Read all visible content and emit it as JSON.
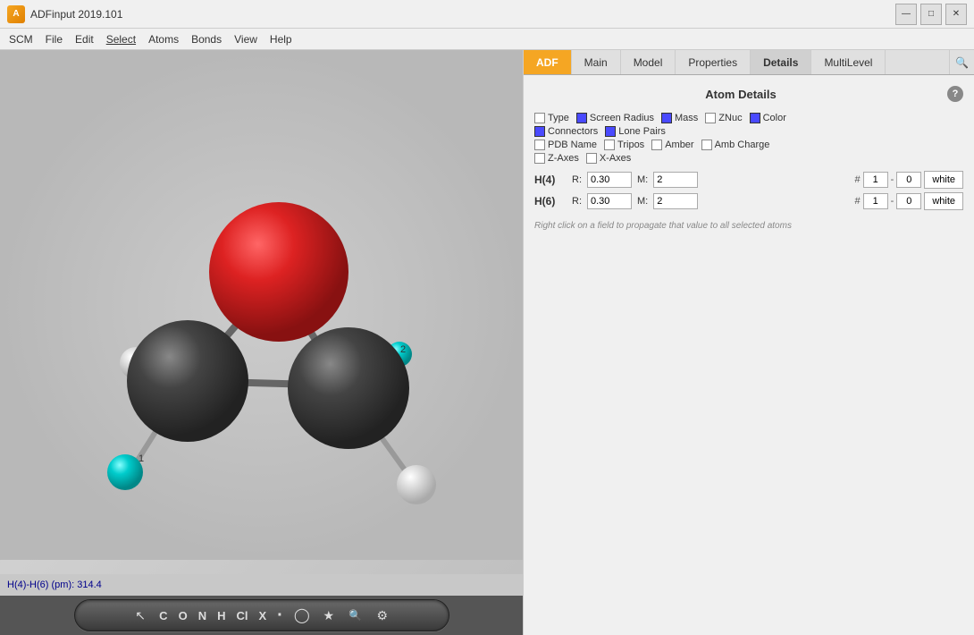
{
  "app": {
    "title": "ADFinput 2019.101",
    "icon_label": "A"
  },
  "titlebar": {
    "minimize_label": "—",
    "maximize_label": "□",
    "close_label": "✕"
  },
  "menubar": {
    "items": [
      {
        "label": "SCM"
      },
      {
        "label": "File"
      },
      {
        "label": "Edit"
      },
      {
        "label": "Select"
      },
      {
        "label": "Atoms"
      },
      {
        "label": "Bonds"
      },
      {
        "label": "View"
      },
      {
        "label": "Help"
      }
    ]
  },
  "tabs": [
    {
      "label": "ADF",
      "active": true
    },
    {
      "label": "Main"
    },
    {
      "label": "Model"
    },
    {
      "label": "Properties"
    },
    {
      "label": "Details",
      "bold": true
    },
    {
      "label": "MultiLevel"
    }
  ],
  "section_title": "Atom Details",
  "help_label": "?",
  "atom_details": {
    "checkboxes": [
      {
        "label": "Type",
        "checked": false,
        "color": "white"
      },
      {
        "label": "Screen Radius",
        "checked": true,
        "color": "blue"
      },
      {
        "label": "Mass",
        "checked": true,
        "color": "blue"
      },
      {
        "label": "ZNuc",
        "checked": false,
        "color": "white"
      },
      {
        "label": "Color",
        "checked": true,
        "color": "blue"
      },
      {
        "label": "Connectors",
        "checked": true,
        "color": "blue"
      },
      {
        "label": "Lone Pairs",
        "checked": true,
        "color": "blue"
      },
      {
        "label": "",
        "checked": false,
        "color": ""
      },
      {
        "label": "",
        "checked": false,
        "color": ""
      },
      {
        "label": "",
        "checked": false,
        "color": ""
      },
      {
        "label": "PDB Name",
        "checked": false,
        "color": "white"
      },
      {
        "label": "Tripos",
        "checked": false,
        "color": "white"
      },
      {
        "label": "Amber",
        "checked": false,
        "color": "white"
      },
      {
        "label": "Amb Charge",
        "checked": false,
        "color": "white"
      },
      {
        "label": "",
        "checked": false,
        "color": ""
      },
      {
        "label": "Z-Axes",
        "checked": false,
        "color": "white"
      },
      {
        "label": "X-Axes",
        "checked": false,
        "color": "white"
      }
    ]
  },
  "atoms": [
    {
      "label": "H(4)",
      "r_label": "R:",
      "r_value": "0.30",
      "m_label": "M:",
      "m_value": "2",
      "hash": "#",
      "n1": "1",
      "dash": "-",
      "n2": "0",
      "color_label": "white"
    },
    {
      "label": "H(6)",
      "r_label": "R:",
      "r_value": "0.30",
      "m_label": "M:",
      "m_value": "2",
      "hash": "#",
      "n1": "1",
      "dash": "-",
      "n2": "0",
      "color_label": "white"
    }
  ],
  "tip_text": "Right click on a field to propagate that value to all selected atoms",
  "status_bar": {
    "text": "H(4)-H(6) (pm): 314.4"
  },
  "toolbar": {
    "icons": [
      {
        "name": "cursor",
        "symbol": "↖"
      },
      {
        "name": "carbon-c",
        "symbol": "C"
      },
      {
        "name": "oxygen-o",
        "symbol": "O"
      },
      {
        "name": "nitrogen-n",
        "symbol": "N"
      },
      {
        "name": "hydrogen-h",
        "symbol": "H"
      },
      {
        "name": "chlorine-cl",
        "symbol": "Cl"
      },
      {
        "name": "ex-x",
        "symbol": "X"
      },
      {
        "name": "dot",
        "symbol": "·"
      },
      {
        "name": "gear",
        "symbol": "⚙"
      },
      {
        "name": "star",
        "symbol": "★"
      },
      {
        "name": "search",
        "symbol": "🔍"
      },
      {
        "name": "settings",
        "symbol": "⚙"
      }
    ]
  }
}
